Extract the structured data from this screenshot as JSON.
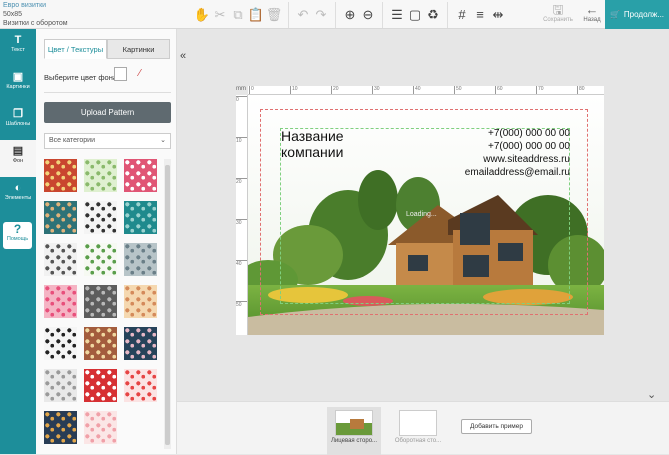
{
  "product": {
    "name": "Евро визитки",
    "size": "50x85",
    "option": "Визитки с оборотом"
  },
  "toolbar": {
    "save": "Сохранить",
    "back": "Назад",
    "next": "Продолж...",
    "tools": [
      "hand-icon",
      "cut-icon",
      "copy-icon",
      "paste-icon",
      "delete-icon",
      "undo-icon",
      "redo-icon",
      "zoom-in-icon",
      "zoom-out-icon",
      "layers-icon",
      "text-frame-icon",
      "recycle-icon",
      "grid-icon",
      "align-icon",
      "distribute-icon"
    ]
  },
  "nav": [
    {
      "icon": "T",
      "label": "Текст"
    },
    {
      "icon": "▣",
      "label": "Картинки"
    },
    {
      "icon": "❐",
      "label": "Шаблоны"
    },
    {
      "icon": "▤",
      "label": "Фон"
    },
    {
      "icon": "◐",
      "label": "Элементы"
    }
  ],
  "help": {
    "icon": "?",
    "label": "Помощь"
  },
  "panel": {
    "tabs": [
      "Цвет / Текстуры",
      "Картинки"
    ],
    "bg_label": "Выберите цвет фона",
    "upload": "Upload Pattern",
    "category": "Все категории"
  },
  "patterns": [
    {
      "color": "#c9462f",
      "accent": "#f2d27a"
    },
    {
      "color": "#dff0d0",
      "accent": "#8ab96b"
    },
    {
      "color": "#e05575",
      "accent": "#ffffff"
    },
    {
      "color": "#2d7277",
      "accent": "#e0b27a"
    },
    {
      "color": "#f4f4f4",
      "accent": "#333333"
    },
    {
      "color": "#1f8a8d",
      "accent": "#9ad2cf"
    },
    {
      "color": "#f1f1f1",
      "accent": "#555555"
    },
    {
      "color": "#f6f9f2",
      "accent": "#5a9e4b"
    },
    {
      "color": "#b7c4c8",
      "accent": "#6a7f88"
    },
    {
      "color": "#f5b4c4",
      "accent": "#e84f7b"
    },
    {
      "color": "#5d5d5d",
      "accent": "#b9b9b9"
    },
    {
      "color": "#f5d8b0",
      "accent": "#d48a5a"
    },
    {
      "color": "#f5f5f5",
      "accent": "#222222"
    },
    {
      "color": "#a35c3d",
      "accent": "#f0d7a0"
    },
    {
      "color": "#26435a",
      "accent": "#e6b8c6"
    },
    {
      "color": "#e9e9e9",
      "accent": "#9a9a9a"
    },
    {
      "color": "#d63033",
      "accent": "#ffffff"
    },
    {
      "color": "#fbe3e3",
      "accent": "#e64444"
    },
    {
      "color": "#283c55",
      "accent": "#e2a64a"
    },
    {
      "color": "#fbe6e6",
      "accent": "#f0a0a8"
    }
  ],
  "ruler": {
    "unit": "mm",
    "top": [
      "0",
      "10",
      "20",
      "30",
      "40",
      "50",
      "60",
      "70",
      "80"
    ],
    "left": [
      "0",
      "10",
      "20",
      "30",
      "40",
      "50"
    ]
  },
  "card": {
    "company_line1": "Название",
    "company_line2": "компании",
    "phone1": "+7(000) 000 00 00",
    "phone2": "+7(000) 000 00 00",
    "site": "www.siteaddress.ru",
    "email": "emailaddress@email.ru",
    "loading": "Loading..."
  },
  "pages": {
    "front": "Лицевая сторо...",
    "back": "Оборотная сто...",
    "add": "Добавить пример"
  },
  "colors": {
    "accent": "#29a0a8",
    "nav": "#1d8e9a"
  }
}
